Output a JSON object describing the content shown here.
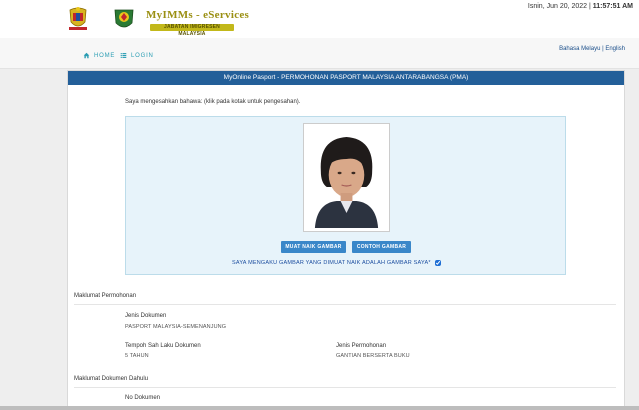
{
  "header": {
    "brand": "MyIMMs - eServices",
    "brand_sub": "JABATAN IMIGRESEN MALAYSIA",
    "datetime_prefix": "Isnin, Jun 20, 2022 | ",
    "datetime_time": "11:57:51 AM"
  },
  "nav": {
    "home": "HOME",
    "login": "LOGIN",
    "language": "Bahasa Melayu | English"
  },
  "panel": {
    "title": "MyOnline Pasport - PERMOHONAN PASPORT MALAYSIA ANTARABANGSA (PMA)",
    "confirm_text": "Saya mengesahkan bahawa: (klik pada kotak untuk pengesahan).",
    "upload_button": "MUAT NAIK GAMBAR",
    "sample_button": "CONTOH GAMBAR",
    "declaration": "SAYA MENGAKU GAMBAR YANG DIMUAT NAIK ADALAH GAMBAR SAYA*",
    "declaration_checked": true
  },
  "application_info": {
    "section_title": "Maklumat Permohonan",
    "document_type_label": "Jenis Dokumen",
    "document_type_value": "PASPORT MALAYSIA-SEMENANJUNG",
    "validity_label": "Tempoh Sah Laku Dokumen",
    "validity_value": "5 TAHUN",
    "application_type_label": "Jenis Permohonan",
    "application_type_value": "GANTIAN BERSERTA BUKU"
  },
  "previous_document": {
    "section_title": "Maklumat Dokumen Dahulu",
    "document_no_label": "No Dokumen"
  },
  "colors": {
    "panel_header": "#235f99",
    "button": "#3a87c9",
    "nav_link": "#2a9db3",
    "photo_box": "#e7f3fa"
  }
}
